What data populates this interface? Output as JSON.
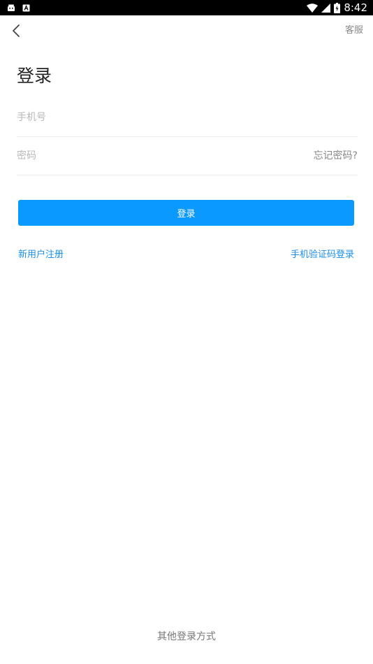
{
  "status_bar": {
    "time": "8:42",
    "icons": [
      "android-icon",
      "notification-a-icon",
      "wifi-icon",
      "signal-icon",
      "battery-icon"
    ]
  },
  "nav": {
    "back_icon": "chevron-left-icon",
    "service_label": "客服"
  },
  "page_title": "登录",
  "form": {
    "phone_placeholder": "手机号",
    "phone_value": "",
    "password_placeholder": "密码",
    "password_value": "",
    "forgot_label": "忘记密码?"
  },
  "login_button_label": "登录",
  "links": {
    "register": "新用户注册",
    "sms_login": "手机验证码登录"
  },
  "other_login_label": "其他登录方式",
  "colors": {
    "primary": "#0a99ff",
    "link": "#1a8ff0",
    "status_bar": "#000000"
  }
}
